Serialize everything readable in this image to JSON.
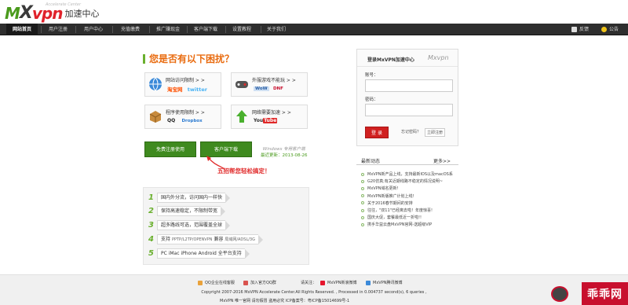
{
  "header": {
    "logo_m": "M",
    "logo_x": "X",
    "logo_vpn": "vpn",
    "logo_cn": "加速中心",
    "logo_sub": "Accelerate Center"
  },
  "nav": {
    "items": [
      "网站首页",
      "用户注册",
      "用户中心",
      "充值缴费",
      "推广赚现金",
      "客户端下载",
      "设置教程",
      "关于我们"
    ],
    "right": [
      "反馈",
      "公告"
    ]
  },
  "promo": {
    "title": "您是否有以下困扰？",
    "features": [
      {
        "title": "网站访问限制 > >",
        "logos": [
          "淘宝网",
          "twitter"
        ],
        "icon": "globe-icon"
      },
      {
        "title": "外服游戏不能玩 > >",
        "logos": [
          "WoW",
          "DNF"
        ],
        "icon": "gamepad-icon"
      },
      {
        "title": "程序使用限制 > >",
        "logos": [
          "QQ",
          "Dropbox"
        ],
        "icon": "box-icon"
      },
      {
        "title": "网络需要加速 > >",
        "logos": [
          "You",
          "Tube"
        ],
        "icon": "arrow-up-icon"
      }
    ],
    "btn_register": "免费注册使用",
    "btn_download": "客户端下载",
    "side_note_1": "Windows 专用客户端",
    "side_note_2": "最近更新：2013-08-26",
    "red_note": "五招帮您轻松搞定！",
    "steps": [
      {
        "num": "1",
        "text": "国内外分流，访问国内一样快"
      },
      {
        "num": "2",
        "text": "保持高速稳定，不限制带宽"
      },
      {
        "num": "3",
        "text": "超多路线可选，范围覆盖全球"
      },
      {
        "num": "4",
        "text_a": "支持",
        "text_b": "PPTP/L2TP/OPENVPN",
        "text_c": "兼容",
        "text_d": "局域网/ADSL/3G"
      },
      {
        "num": "5",
        "text": "PC iMac iPhone Android 全平台支持"
      }
    ]
  },
  "login": {
    "title": "登录MxVPN加速中心",
    "brand": "Mxvpn",
    "account_label": "账号：",
    "password_label": "密码：",
    "login_btn": "登 录",
    "forgot": "忘记密码？",
    "register": "立即注册"
  },
  "news": {
    "title": "最新动态",
    "more": "更多>>",
    "items": [
      "MxVPN新产品上线，支持最新IOS以及macOS系",
      "G20仿真;有关近期线路不稳定的情况说明~",
      "MxVPN域名更新!",
      "MxVPN新版推广计划上线!",
      "关于2016春节期间的安排",
      "往往，\"双11\"已经离去啦！年度惊喜!",
      "国庆大促，套餐最低近一折啦!!",
      "携手华益云盘MxVPN官网-送超级VIP"
    ]
  },
  "footer": {
    "links": [
      "QQ企业在线客服",
      "加入官方QQ群",
      "请关注：",
      "MxVPN新浪微博",
      "MxVPN腾讯微博"
    ],
    "copyright": "Copyright 2007-2016 MxVPN Accelerate Center.All Rights Reserved. , Processed in 0.004737 second(s), 6 queries ,",
    "bottom": "MxVPN   唯一官网 请勿假冒 盗用必究   ICP备案号：粤ICP备15014699号-1",
    "badge": "乖乖网"
  }
}
